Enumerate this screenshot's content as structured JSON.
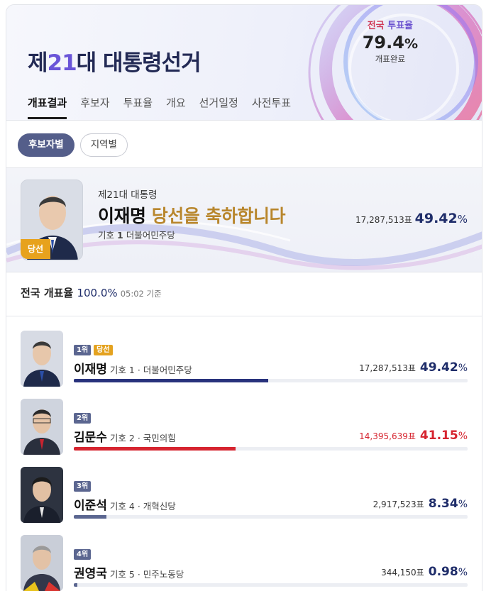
{
  "header": {
    "title_prefix": "제",
    "title_num": "21",
    "title_suffix": "대 대통령선거",
    "turnout_label_a": "전국",
    "turnout_label_b": "투표율",
    "turnout_value": "79.4",
    "turnout_pct": "%",
    "turnout_status": "개표완료"
  },
  "tabs": [
    "개표결과",
    "후보자",
    "투표율",
    "개요",
    "선거일정",
    "사전투표"
  ],
  "filters": [
    "후보자별",
    "지역별"
  ],
  "winner": {
    "top": "제21대 대통령",
    "name": "이재명",
    "congrats": "당선을 축하합니다",
    "number_label": "기호",
    "number": "1",
    "party": "더불어민주당",
    "badge": "당선",
    "votes": "17,287,513표",
    "percent": "49.42",
    "pct": "%"
  },
  "national": {
    "label": "전국 개표율",
    "value": "100.0",
    "pct": "%",
    "time": "05:02 기준"
  },
  "candidates": [
    {
      "rank": "1위",
      "elected": "당선",
      "name": "이재명",
      "number": "기호 1",
      "party": "더불어민주당",
      "votes": "17,287,513표",
      "percent": "49.42",
      "share": 49.42
    },
    {
      "rank": "2위",
      "name": "김문수",
      "number": "기호 2",
      "party": "국민의힘",
      "votes": "14,395,639표",
      "percent": "41.15",
      "share": 41.15
    },
    {
      "rank": "3위",
      "name": "이준석",
      "number": "기호 4",
      "party": "개혁신당",
      "votes": "2,917,523표",
      "percent": "8.34",
      "share": 8.34
    },
    {
      "rank": "4위",
      "name": "권영국",
      "number": "기호 5",
      "party": "민주노동당",
      "votes": "344,150표",
      "percent": "0.98",
      "share": 0.98
    }
  ],
  "colors": {
    "navy": "#28327c",
    "red": "#d6242f",
    "gray": "#5b6690",
    "gold": "#e4a21f"
  }
}
